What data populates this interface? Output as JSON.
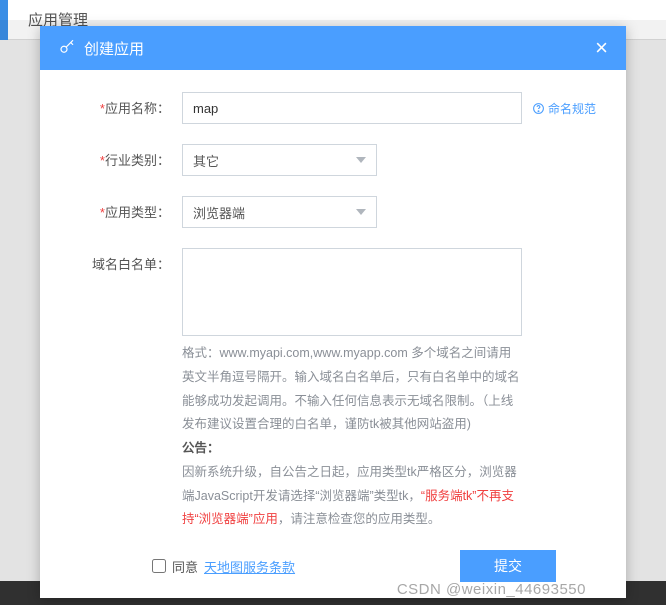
{
  "background": {
    "page_title": "应用管理"
  },
  "modal": {
    "title": "创建应用",
    "close": "×",
    "fields": {
      "app_name": {
        "label": "应用名称：",
        "value": "map",
        "naming_link": "命名规范"
      },
      "industry": {
        "label": "行业类别：",
        "value": "其它"
      },
      "app_type": {
        "label": "应用类型：",
        "value": "浏览器端"
      },
      "whitelist": {
        "label": "域名白名单：",
        "value": ""
      }
    },
    "help": {
      "line1": "格式：www.myapi.com,www.myapp.com 多个域名之间请用英文半角逗号隔开。输入域名白名单后，只有白名单中的域名能够成功发起调用。不输入任何信息表示无域名限制。（上线发布建议设置合理的白名单，谨防tk被其他网站盗用)",
      "notice_label": "公告：",
      "notice_part1": "因新系统升级，自公告之日起，应用类型tk严格区分，浏览器端JavaScript开发请选择“浏览器端”类型tk，",
      "notice_red": "“服务端tk”不再支持“浏览器端”应用",
      "notice_part2": "，请注意检查您的应用类型。"
    },
    "footer": {
      "agree_prefix": "同意",
      "agree_link": "天地图服务条款",
      "submit": "提交"
    }
  },
  "watermark": "CSDN @weixin_44693550"
}
